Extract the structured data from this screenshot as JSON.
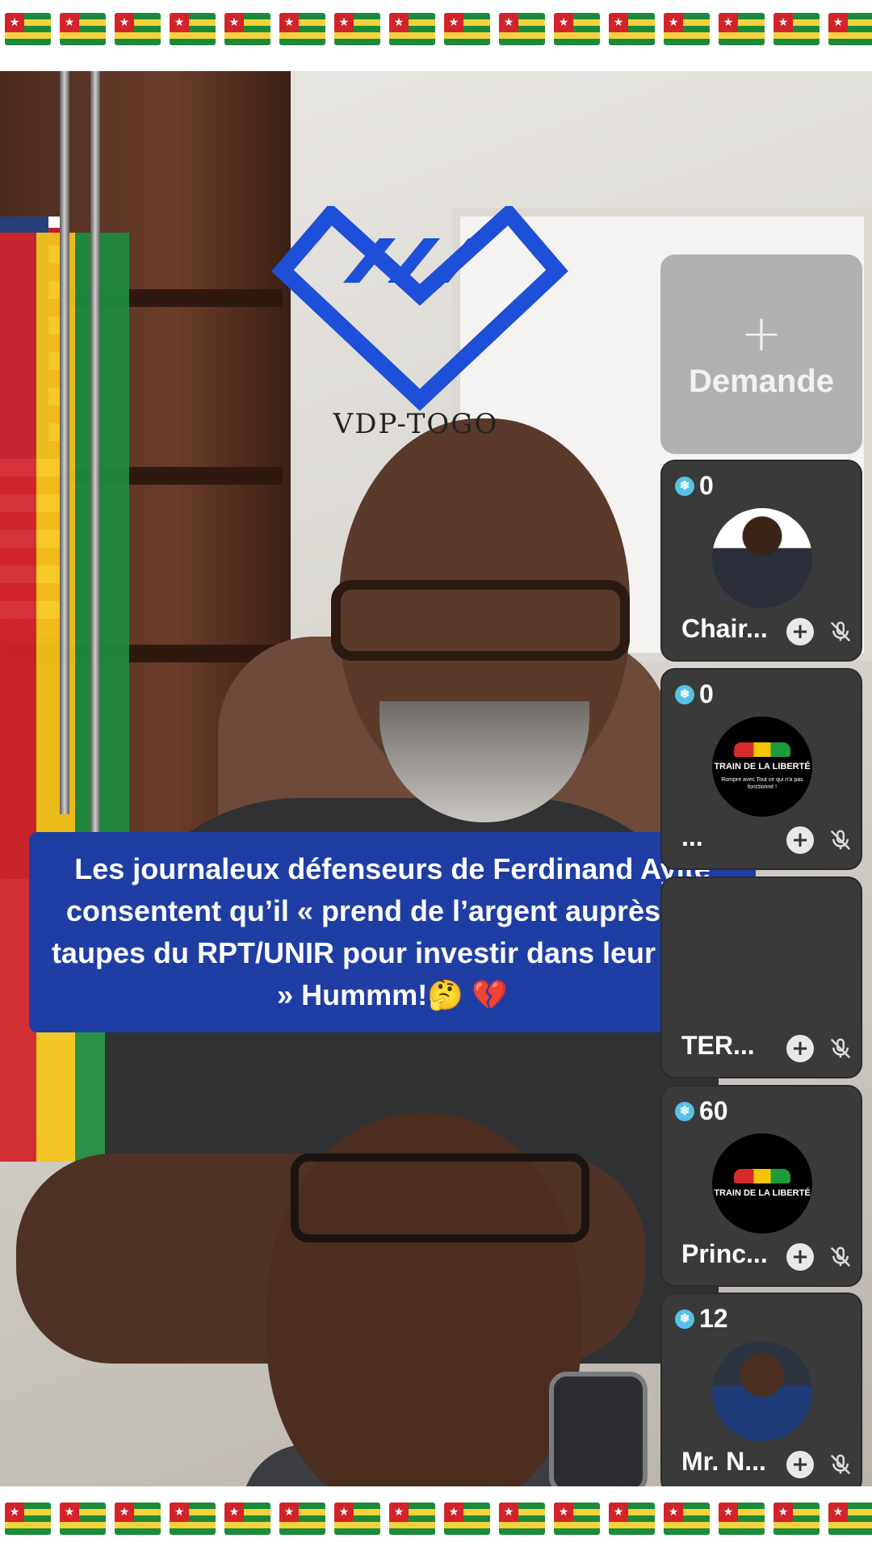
{
  "decor": {
    "flag_emoji": "togo-flag",
    "flag_colors": {
      "green": "#1b8a3a",
      "yellow": "#f5d23b",
      "red": "#d2232a"
    }
  },
  "watermark": {
    "text": "VDP-TOGO",
    "color": "#1e4fd8"
  },
  "caption": {
    "text": "Les journaleux défenseurs de Ferdinand Ayité consentent qu’il « prend de l’argent auprès des taupes du RPT/UNIR pour investir dans leur lutte. » Hummm!🤔 💔",
    "background": "#1f3ea4"
  },
  "request_panel": {
    "plus": "+",
    "label": "Demande"
  },
  "guests": [
    {
      "count": "0",
      "name": "Chair...",
      "avatar": "person-avatar",
      "muted": true
    },
    {
      "count": "0",
      "name": "...",
      "avatar": "train-logo-avatar",
      "muted": true,
      "logo_title": "TRAIN DE LA LIBERTÉ",
      "logo_sub": "Rompre avec Tout ce qui n'a pas fonctionné !"
    },
    {
      "count": "",
      "name": "TER...",
      "avatar": "placeholder",
      "muted": true
    },
    {
      "count": "60",
      "name": "Princ...",
      "avatar": "train-logo-avatar",
      "muted": true,
      "logo_title": "TRAIN DE LA LIBERTÉ"
    },
    {
      "count": "12",
      "name": "Mr. N...",
      "avatar": "person-avatar",
      "muted": true
    }
  ],
  "icons": {
    "add": "+",
    "gem": "❄",
    "mute": "mic-off-icon"
  }
}
